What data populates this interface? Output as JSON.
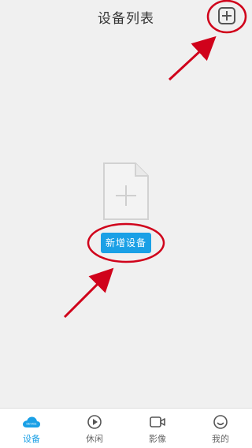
{
  "header": {
    "title": "设备列表"
  },
  "empty_state": {
    "button_label": "新增设备"
  },
  "tabs": [
    {
      "label": "设备",
      "icon": "cloud-icon",
      "active": true
    },
    {
      "label": "休闲",
      "icon": "play-circle-icon",
      "active": false
    },
    {
      "label": "影像",
      "icon": "video-camera-icon",
      "active": false
    },
    {
      "label": "我的",
      "icon": "smiley-icon",
      "active": false
    }
  ],
  "colors": {
    "accent": "#1aa0e6",
    "annotation": "#d0021b",
    "background": "#f0f0f0"
  }
}
